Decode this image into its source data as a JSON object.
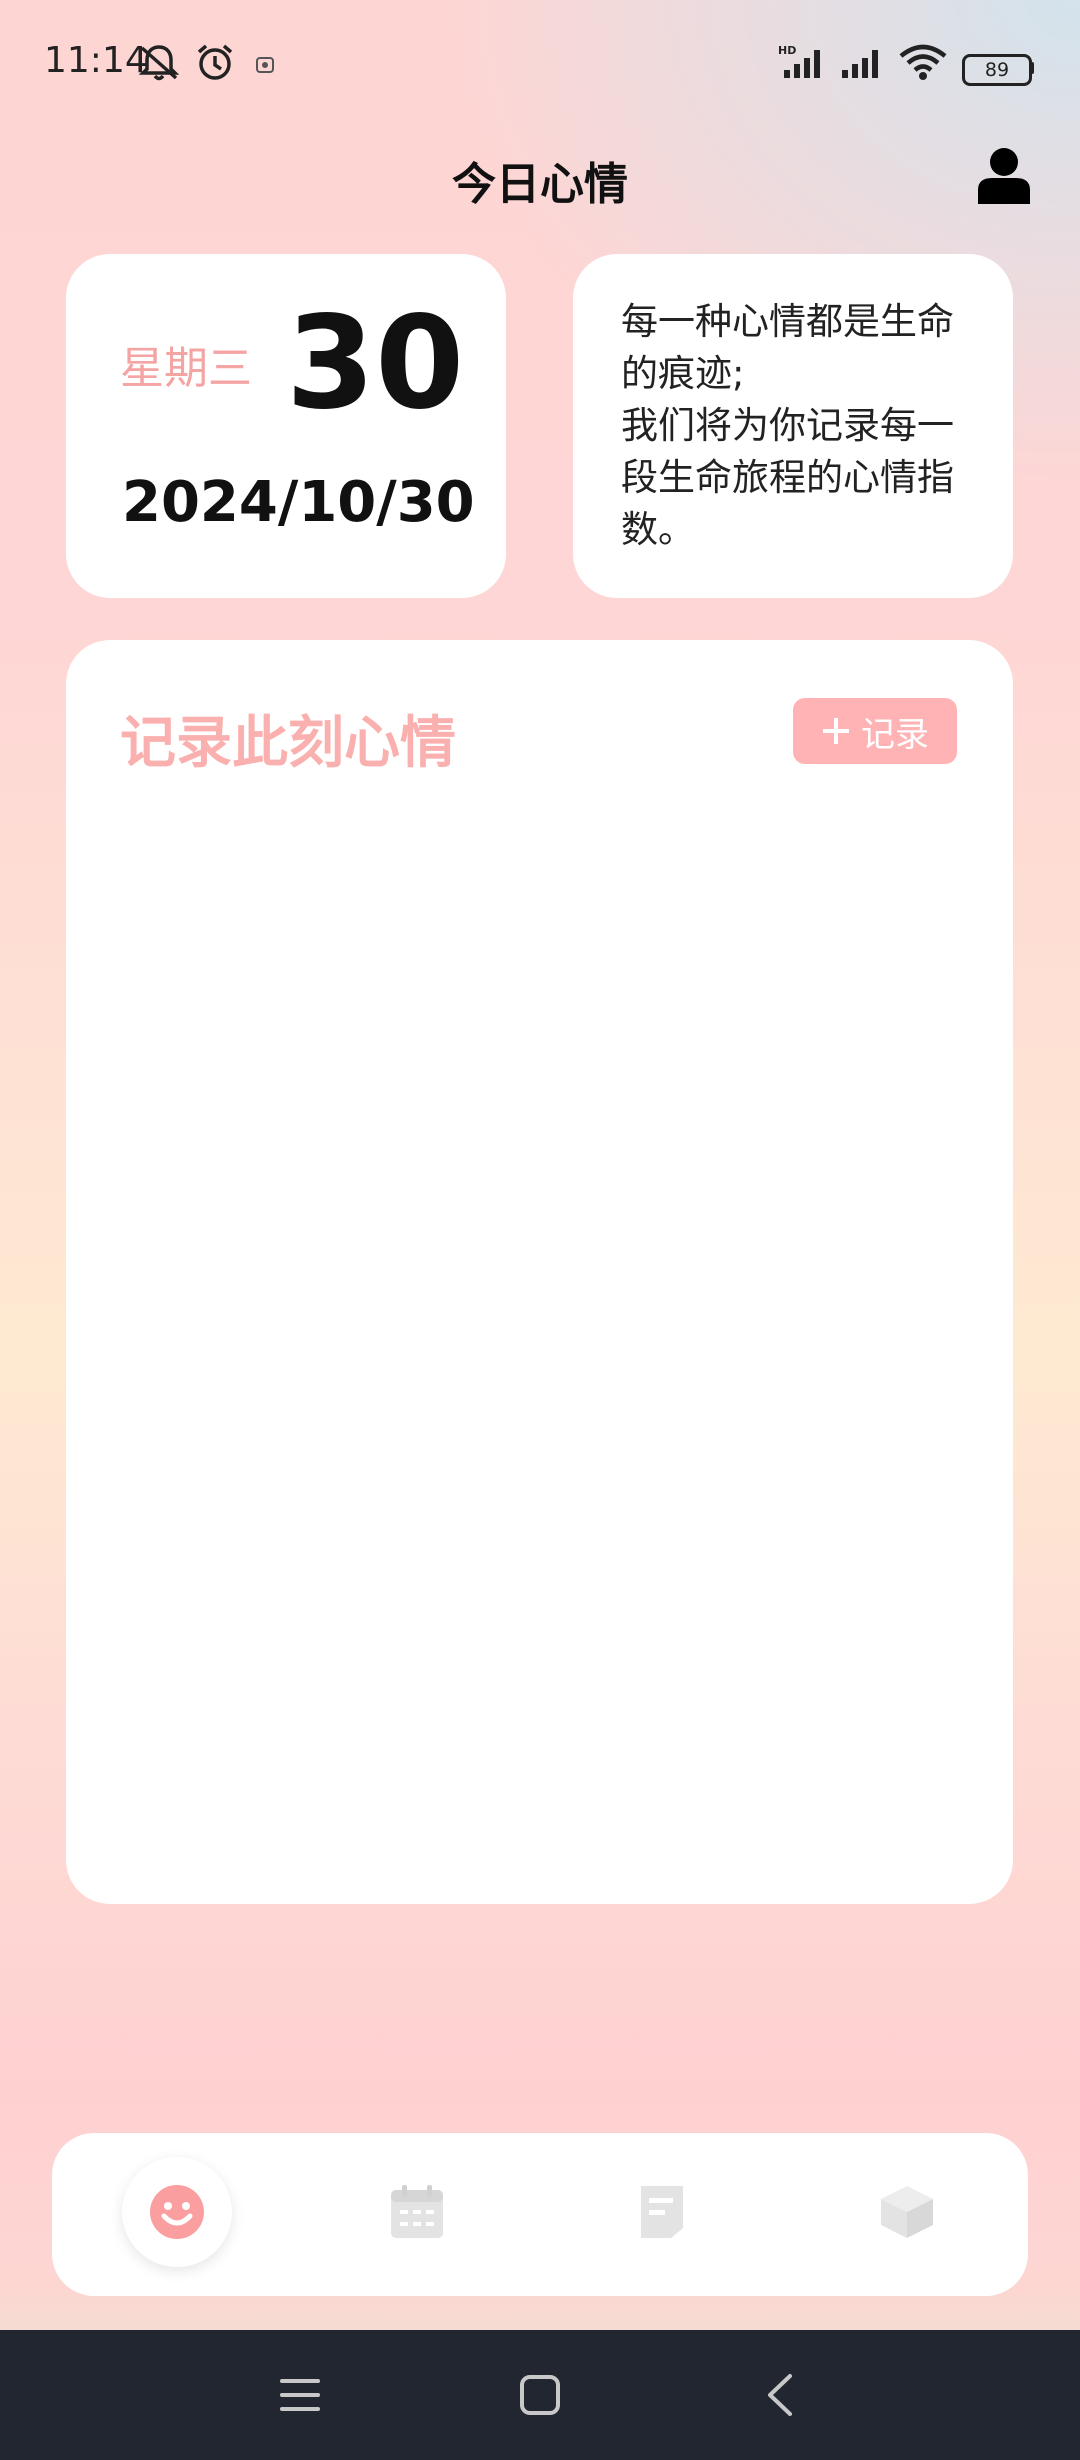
{
  "status_bar": {
    "time": "11:14",
    "icons": [
      "mute-bell-icon",
      "alarm-icon",
      "notification-icon",
      "hd-signal-icon",
      "signal-icon",
      "wifi-icon"
    ],
    "battery": "89"
  },
  "header": {
    "title": "今日心情",
    "user_icon": "user-icon"
  },
  "date_card": {
    "weekday": "星期三",
    "day": "30",
    "full_date": "2024/10/30",
    "weekday_color": "#f4a4a3"
  },
  "quote_card": {
    "text": "每一种心情都是生命的痕迹;\n我们将为你记录每一段生命旅程的心情指数。"
  },
  "record_card": {
    "title": "记录此刻心情",
    "button_label": "记录",
    "button_icon": "plus-icon",
    "accent_color": "#ffb3b4"
  },
  "tabbar": {
    "tabs": [
      {
        "icon": "smile-icon",
        "active": true
      },
      {
        "icon": "calendar-icon",
        "active": false
      },
      {
        "icon": "note-icon",
        "active": false
      },
      {
        "icon": "cube-icon",
        "active": false
      }
    ],
    "active_color": "#fb9ea0",
    "inactive_color": "#e3e3e3"
  },
  "nav_bar": {
    "buttons": [
      "menu-icon",
      "home-icon",
      "back-icon"
    ]
  }
}
